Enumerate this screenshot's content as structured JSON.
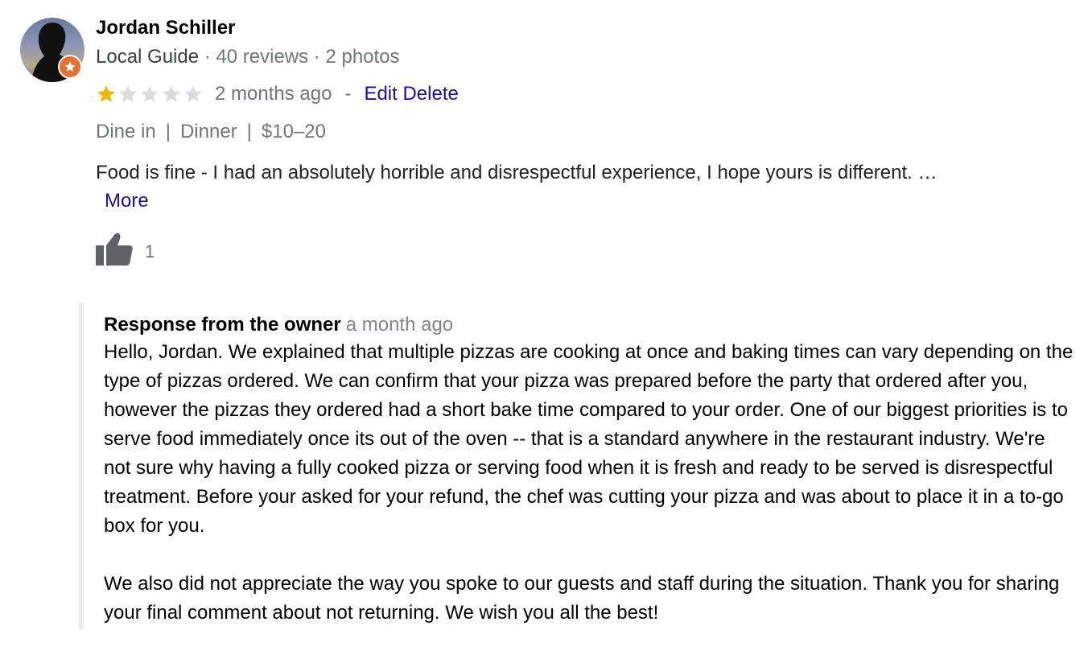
{
  "reviewer": {
    "name": "Jordan Schiller",
    "guide_label": "Local Guide",
    "reviews": "40 reviews",
    "photos": "2 photos",
    "badge_color": "#e8712f",
    "avatar_icon": "user-silhouette"
  },
  "rating": {
    "stars": 1,
    "max_stars": 5,
    "star_filled_color": "#f4b400",
    "star_empty_color": "#dadce0",
    "time": "2 months ago",
    "separator": "-",
    "edit_label": "Edit",
    "delete_label": "Delete"
  },
  "details": {
    "service": "Dine in",
    "meal": "Dinner",
    "price": "$10–20"
  },
  "review": {
    "text": "Food is fine - I had an absolutely horrible and disrespectful experience, I hope yours is different. …",
    "more_label": "More"
  },
  "likes": {
    "icon": "thumbs-up-icon",
    "count": "1"
  },
  "owner_response": {
    "title": "Response from the owner",
    "time": "a month ago",
    "paragraphs": [
      "Hello, Jordan. We explained that multiple pizzas are cooking at once and baking times can vary depending on the type of pizzas ordered. We can confirm that your pizza was prepared before the party that ordered after you, however the pizzas they ordered had a short bake time compared to your order. One of our biggest priorities is to serve food immediately once its out of the oven -- that is a standard anywhere in the restaurant industry. We're not sure why having a fully cooked pizza or serving food when it is fresh and ready to be served is disrespectful treatment. Before your asked for your refund, the chef was cutting your pizza and was about to place it in a to-go box for you.",
      "We also did not appreciate the way you spoke to our guests and staff during the situation. Thank you for sharing your final comment about not returning. We wish you all the best!"
    ]
  }
}
